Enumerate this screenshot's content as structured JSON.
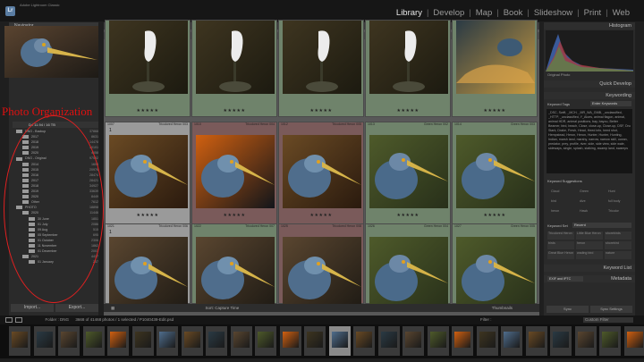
{
  "app": {
    "logo": "Lr",
    "name": "Adobe Lightroom Classic"
  },
  "modules": [
    "Library",
    "Develop",
    "Map",
    "Book",
    "Slideshow",
    "Print",
    "Web"
  ],
  "active_module": "Library",
  "left_panel": {
    "navigator": "Navigator",
    "annotation": "Photo Organization",
    "drive": "D:",
    "drive_info": "D:\\   11.94 / 16 TB",
    "folders": [
      {
        "name": "DNG - Backup",
        "count": "37868",
        "level": 1
      },
      {
        "name": "2017",
        "count": "8631",
        "level": 2
      },
      {
        "name": "2018",
        "count": "14478",
        "level": 2
      },
      {
        "name": "2019",
        "count": "10101",
        "level": 2
      },
      {
        "name": "2020",
        "count": "4658",
        "level": 2
      },
      {
        "name": "DNG - Original",
        "count": "97592",
        "level": 1
      },
      {
        "name": "2014",
        "count": "1608",
        "level": 2
      },
      {
        "name": "2015",
        "count": "20976",
        "level": 2
      },
      {
        "name": "2016",
        "count": "28474",
        "level": 2
      },
      {
        "name": "2017",
        "count": "28421",
        "level": 2
      },
      {
        "name": "2018",
        "count": "34927",
        "level": 2
      },
      {
        "name": "2019",
        "count": "33639",
        "level": 2
      },
      {
        "name": "2020",
        "count": "8449",
        "level": 2
      },
      {
        "name": "Other",
        "count": "7612",
        "level": 2
      },
      {
        "name": "PHOTO",
        "count": "18898",
        "level": 1
      },
      {
        "name": "2020",
        "count": "11446",
        "level": 2
      },
      {
        "name": "30 June",
        "count": "1851",
        "level": 3
      },
      {
        "name": "01 July",
        "count": "2086",
        "level": 3
      },
      {
        "name": "09 Aug",
        "count": "515",
        "level": 3
      },
      {
        "name": "05 September",
        "count": "695",
        "level": 3
      },
      {
        "name": "01 October",
        "count": "2306",
        "level": 3
      },
      {
        "name": "11 November",
        "count": "1862",
        "level": 3
      },
      {
        "name": "01 December",
        "count": "2003",
        "level": 3
      },
      {
        "name": "2021",
        "count": "4417",
        "level": 2
      },
      {
        "name": "01 January",
        "count": "257",
        "level": 3
      }
    ],
    "import": "Import...",
    "export": "Export..."
  },
  "center": {
    "filter_title": "Library Filter :",
    "filter_options": [
      "Text",
      "Attribute",
      "Metadata",
      "None"
    ],
    "filter_active": "Attribute",
    "filter_right": "Custom Filter",
    "grid": [
      {
        "num": "",
        "name": "",
        "type": "",
        "stars": "★★★★★",
        "style": "green",
        "img": "egret"
      },
      {
        "num": "",
        "name": "",
        "type": "",
        "stars": "★★★★★",
        "style": "green",
        "img": "egret"
      },
      {
        "num": "",
        "name": "",
        "type": "",
        "stars": "★★★★★",
        "style": "green",
        "img": "egret"
      },
      {
        "num": "",
        "name": "",
        "type": "",
        "stars": "★★★★★",
        "style": "green",
        "img": "egret"
      },
      {
        "num": "",
        "name": "",
        "type": "",
        "stars": "★★★★★",
        "style": "green",
        "img": "heron-water"
      },
      {
        "num": "1007",
        "name": "Tricolored Heron 003",
        "type": "DNG",
        "stars": "★★★★★",
        "style": "sel",
        "img": "heron-warm",
        "badge": "1"
      },
      {
        "num": "1010",
        "name": "Tricolored Heron 004",
        "type": "DNG",
        "stars": "★★★★★",
        "style": "red",
        "img": "heron-blue"
      },
      {
        "num": "1012",
        "name": "Tricolored Heron 005",
        "type": "DNG",
        "stars": "★★★★★",
        "style": "red",
        "img": "heron-warm"
      },
      {
        "num": "1013",
        "name": "Green Heron 002",
        "type": "DNG",
        "stars": "★★★★★",
        "style": "green",
        "img": "heron-green"
      },
      {
        "num": "1014",
        "name": "Green Heron 003",
        "type": "DNG",
        "stars": "★★★★★",
        "style": "green",
        "img": "heron-green"
      },
      {
        "num": "1021",
        "name": "Tricolored Heron 006",
        "type": "DNG",
        "stars": "",
        "style": "sel",
        "img": "heron-brown",
        "badge": "1"
      },
      {
        "num": "1022",
        "name": "Tricolored Heron 007",
        "type": "DNG",
        "stars": "",
        "style": "green",
        "img": "heron-brown"
      },
      {
        "num": "1025",
        "name": "Tricolored Heron 008",
        "type": "DNG",
        "stars": "",
        "style": "red",
        "img": "heron-brown"
      },
      {
        "num": "1026",
        "name": "Green Heron 004",
        "type": "DNG",
        "stars": "",
        "style": "green",
        "img": "heron-green"
      },
      {
        "num": "1027",
        "name": "Green Heron 005",
        "type": "DNG",
        "stars": "",
        "style": "green",
        "img": "heron-green"
      }
    ],
    "toolbar_sort": "Sort: Capture Time",
    "toolbar_thumbs": "Thumbnails"
  },
  "right_panel": {
    "histogram": "Histogram",
    "original_photo": "Original Photo",
    "quick_develop": "Quick Develop",
    "keywording": "Keywording",
    "keyword_tags_label": "Keyword Tags",
    "keyword_tags_mode": "Enter Keywords",
    "keyword_text": "_DSC, Swift, _MCH, _MR_WA_GMB, _unclassified, _HTTP, _unclassified, Y_Aloes, animal flagon, animal, animal HDR, animal positions, bay, bayou, Better Beamer, bird, beach, Close, close-up, Close-up, DSF, Dru Stark, Drake, Fresh, Head, Heed info, heed shot, Hempstead, Heron, Heron, Hunter, Hunter, Hunting, Indian, marsh land, marshy, narrow, narrow skill, ocean, predator, prey, profile, river, side, side view, side wale, sideways, single, splash, stalking, swamp land, swamps",
    "keyword_suggestions": "Keyword Suggestions",
    "suggestions": [
      "Cloud",
      "Green",
      "Hunt",
      "bird",
      "dive",
      "full body",
      "heron",
      "Hawk",
      "Tricolor"
    ],
    "keyword_set_label": "Keyword Set",
    "keyword_set": "Recent",
    "keyword_set_items": [
      "Tricolored Heron",
      "Little Blue Heron",
      "shorebirds",
      "birds",
      "heron",
      "shorebird",
      "Great Blue Heron",
      "wading bird",
      "nature"
    ],
    "keyword_list": "Keyword List",
    "metadata": "Metadata",
    "metadata_preset": "EXIF and IPTC",
    "sync": "Sync",
    "sync_settings": "Sync Settings"
  },
  "filmstrip_bar": {
    "path": "Folder : DNG",
    "info": "3668 of 41468 photos / 1 selected / P1040439-Edit.psd",
    "filter_label": "Filter :",
    "filter_value": "Custom Filter"
  },
  "colors": {
    "panel": "#2a2a2a",
    "grid_bg": "#585858",
    "accent": "#5a7da3",
    "annotation": "#e01010"
  }
}
